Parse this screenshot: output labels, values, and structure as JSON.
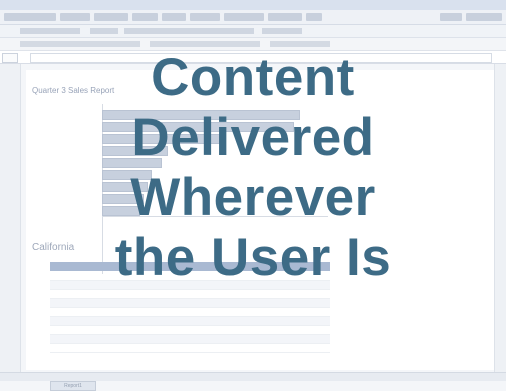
{
  "overlay": {
    "lines": [
      "Content",
      "Delivered",
      "Wherever",
      "the User Is"
    ],
    "color": "#3d6b86"
  },
  "report": {
    "title": "Quarter 3 Sales Report",
    "section_title": "California"
  },
  "bar_chart": {
    "bar_count": 9,
    "bar_color": "#c7d0de"
  },
  "sheet_tab": {
    "label": "Report1"
  }
}
